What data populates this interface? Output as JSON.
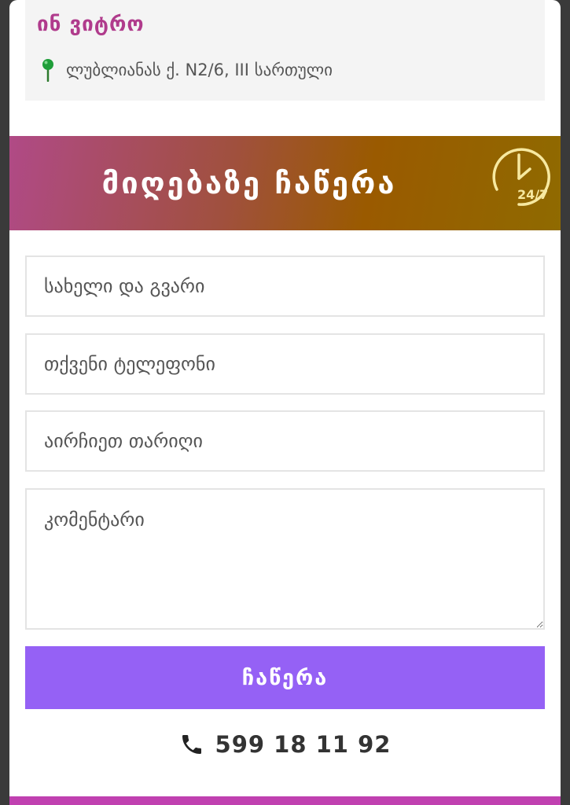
{
  "clinic": {
    "name": "ინ ვიტრო",
    "address": "ლუბლიანას ქ. N2/6, III სართული",
    "pin_icon": "map-pin-icon"
  },
  "banner": {
    "title": "მიღებაზე ჩაწერა",
    "clock_label": "24/7",
    "clock_icon": "clock-24-7-icon"
  },
  "form": {
    "name_placeholder": "სახელი და გვარი",
    "phone_placeholder": "თქვენი ტელეფონი",
    "date_placeholder": "აირჩიეთ თარიღი",
    "comment_placeholder": "კომენტარი",
    "submit_label": "ჩაწერა"
  },
  "contact": {
    "phone": "599 18 11 92",
    "phone_icon": "phone-icon"
  },
  "colors": {
    "accent": "#9561f5",
    "brand": "#b03b8c",
    "pin": "#1f9e3a"
  }
}
